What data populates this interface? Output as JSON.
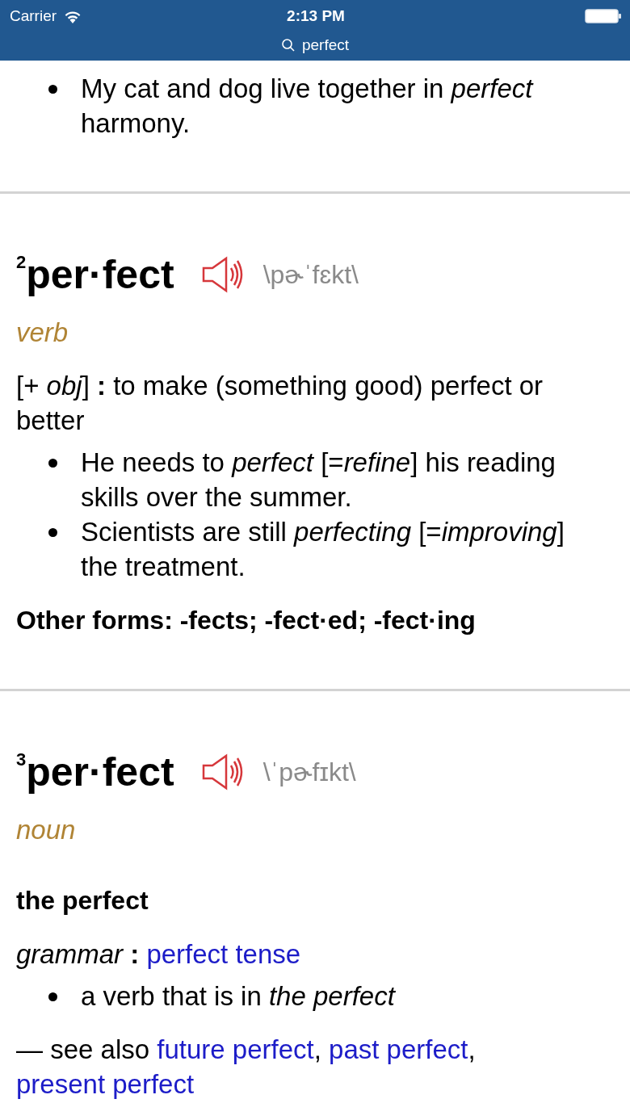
{
  "status_bar": {
    "carrier": "Carrier",
    "time": "2:13 PM"
  },
  "search": {
    "query": "perfect"
  },
  "entries": [
    {
      "examples": [
        "My cat and dog live together in *perfect* harmony."
      ]
    },
    {
      "homograph": "2",
      "headword": "per·fect",
      "pronunciation": "\\pɚˈfɛkt\\",
      "part_of_speech": "verb",
      "senses": [
        {
          "parts": [
            {
              "kind": "text",
              "text": "[+ *obj*] **:** to make (something good) perfect or better"
            }
          ],
          "examples": [
            "He needs to *perfect* [=*refine*] his reading skills over the summer.",
            "Scientists are still *perfecting* [=*improving*] the treatment."
          ]
        }
      ],
      "other_forms": "Other forms: -fects; -fect·ed; -fect·ing"
    },
    {
      "homograph": "3",
      "headword": "per·fect",
      "pronunciation": "\\ˈpɚfɪkt\\",
      "part_of_speech": "noun",
      "phrase": "the perfect",
      "senses": [
        {
          "parts": [
            {
              "kind": "text",
              "text": "*grammar* **:** "
            },
            {
              "kind": "link",
              "text": "perfect tense"
            }
          ],
          "examples": [
            "a verb that is in *the perfect*"
          ]
        }
      ],
      "see_also": [
        {
          "kind": "text",
          "text": "— see also "
        },
        {
          "kind": "link",
          "text": "future perfect"
        },
        {
          "kind": "text",
          "text": ", "
        },
        {
          "kind": "link",
          "text": "past perfect"
        },
        {
          "kind": "text",
          "text": ", "
        },
        {
          "kind": "link",
          "text": "present perfect"
        }
      ]
    }
  ]
}
